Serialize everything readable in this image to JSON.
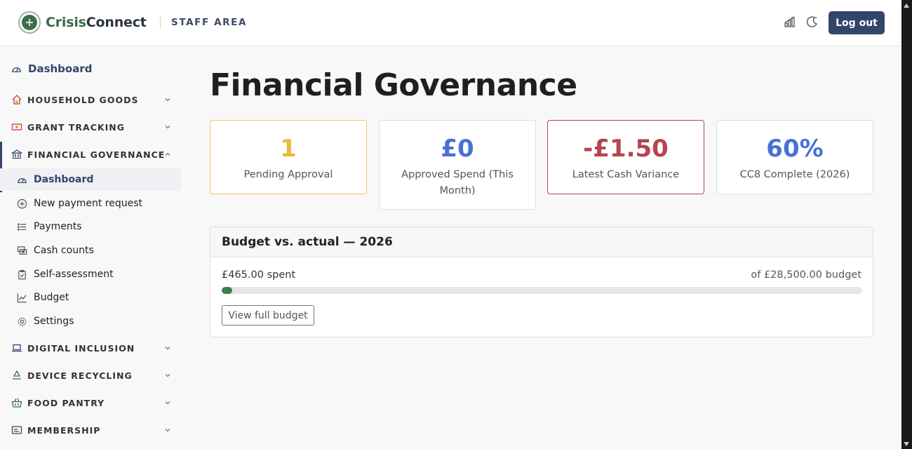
{
  "header": {
    "logo_part1": "Crisis",
    "logo_part2": "Connect",
    "area": "STAFF AREA",
    "logout": "Log out"
  },
  "sidebar": {
    "dashboard": "Dashboard",
    "sections": [
      {
        "label": "HOUSEHOLD GOODS",
        "icon": "house-icon"
      },
      {
        "label": "GRANT TRACKING",
        "icon": "cash-icon"
      },
      {
        "label": "FINANCIAL GOVERNANCE",
        "icon": "bank-icon"
      },
      {
        "label": "DIGITAL INCLUSION",
        "icon": "laptop-icon"
      },
      {
        "label": "DEVICE RECYCLING",
        "icon": "recycle-icon"
      },
      {
        "label": "FOOD PANTRY",
        "icon": "basket-icon"
      },
      {
        "label": "MEMBERSHIP",
        "icon": "id-card-icon"
      }
    ],
    "sub_items": [
      "Dashboard",
      "New payment request",
      "Payments",
      "Cash counts",
      "Self-assessment",
      "Budget",
      "Settings"
    ]
  },
  "main": {
    "title": "Financial Governance",
    "stats": [
      {
        "value": "1",
        "caption": "Pending Approval",
        "color": "#e8b93a",
        "border": "#f0c75a"
      },
      {
        "value": "£0",
        "caption": "Approved Spend (This Month)",
        "color": "#4a6fd8",
        "border": "#dddddd"
      },
      {
        "value": "-£1.50",
        "caption": "Latest Cash Variance",
        "color": "#b5454f",
        "border": "#b5454f"
      },
      {
        "value": "60%",
        "caption": "CC8 Complete (2026)",
        "color": "#4a6fd8",
        "border": "#dddddd"
      }
    ],
    "budget": {
      "title": "Budget vs. actual — 2026",
      "spent": "£465.00 spent",
      "of_budget": "of £28,500.00 budget",
      "progress_fraction": 0.0163,
      "button": "View full budget"
    }
  },
  "colors": {
    "brand": "#34456b",
    "progress": "#3f7b55"
  }
}
